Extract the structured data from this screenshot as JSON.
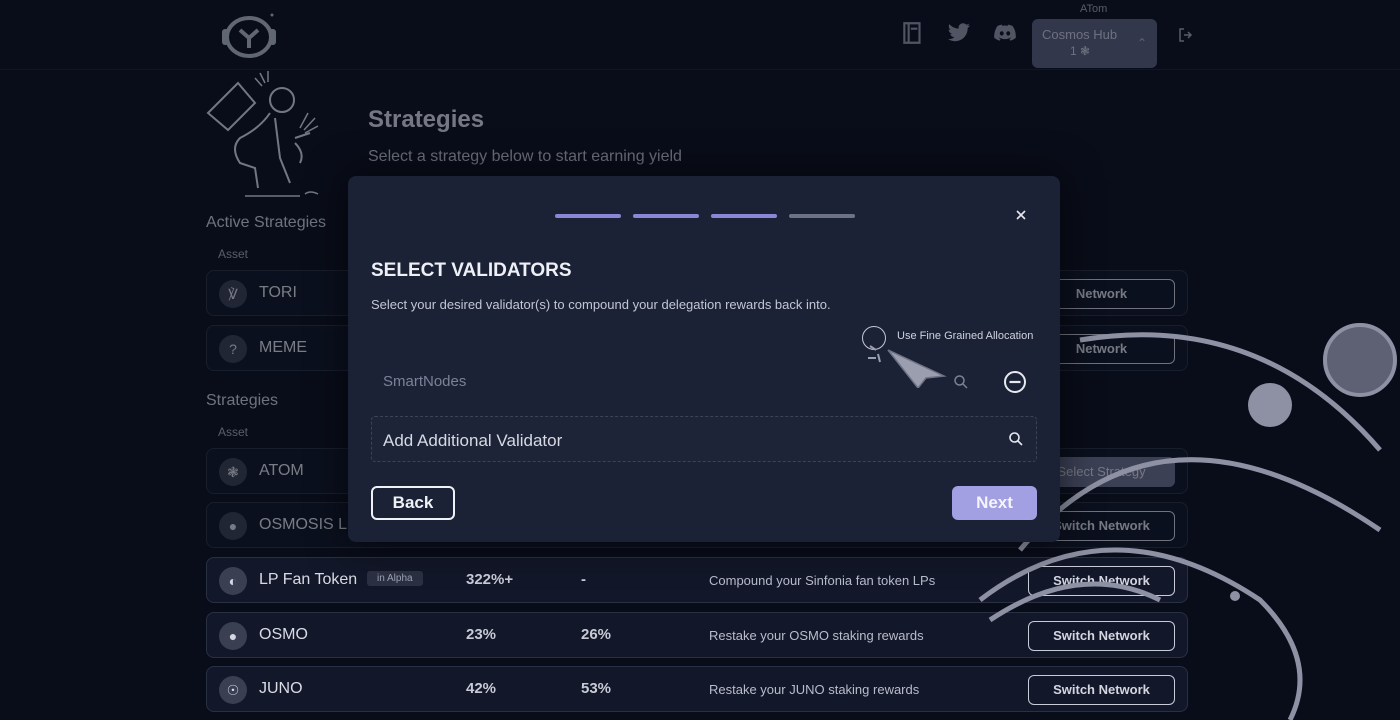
{
  "header": {
    "network_caption": "ATom",
    "network_name": "Cosmos Hub",
    "network_count": "1"
  },
  "page": {
    "title": "Strategies",
    "subtitle": "Select a strategy below to start earning yield"
  },
  "active_strategies": {
    "title": "Active Strategies",
    "asset_header": "Asset",
    "rows": [
      {
        "name": "TORI",
        "button": "Network"
      },
      {
        "name": "MEME",
        "button": "Network"
      }
    ]
  },
  "strategies": {
    "title": "Strategies",
    "asset_header": "Asset",
    "rows": [
      {
        "name": "ATOM",
        "button": "Select Strategy"
      },
      {
        "name": "OSMOSIS LP",
        "button": "Switch Network"
      },
      {
        "name": "LP Fan Token",
        "badge": "in Alpha",
        "apy": "322%+",
        "apr": "-",
        "description": "Compound your Sinfonia fan token LPs",
        "button": "Switch Network"
      },
      {
        "name": "OSMO",
        "apy": "23%",
        "apr": "26%",
        "description": "Restake your OSMO staking rewards",
        "button": "Switch Network"
      },
      {
        "name": "JUNO",
        "apy": "42%",
        "apr": "53%",
        "description": "Restake your JUNO staking rewards",
        "button": "Switch Network"
      }
    ]
  },
  "modal": {
    "steps_total": 4,
    "steps_completed": 3,
    "title": "SELECT VALIDATORS",
    "description": "Select your desired validator(s) to compound your delegation rewards back into.",
    "fine_grained_label": "Use Fine Grained Allocation",
    "validator_name": "SmartNodes",
    "add_validator_label": "Add Additional Validator",
    "back_label": "Back",
    "next_label": "Next"
  },
  "colors": {
    "accent": "#a29fe3",
    "background": "#0d1120",
    "modal": "#1b2236"
  }
}
